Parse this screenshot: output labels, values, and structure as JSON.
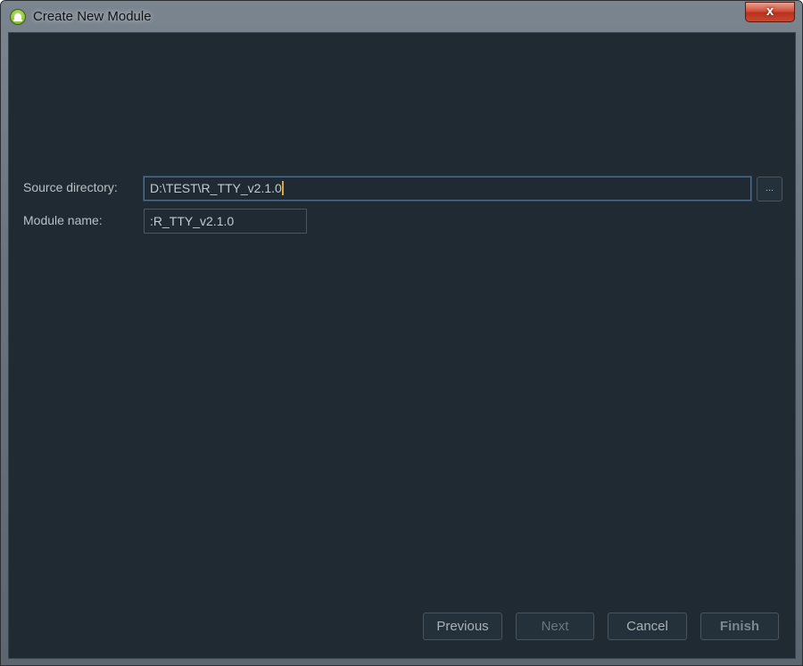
{
  "window": {
    "title": "Create New Module",
    "close_label": "x"
  },
  "form": {
    "source_directory": {
      "label": "Source directory:",
      "value": "D:\\TEST\\R_TTY_v2.1.0",
      "browse_label": "..."
    },
    "module_name": {
      "label": "Module name:",
      "value": ":R_TTY_v2.1.0"
    }
  },
  "buttons": {
    "previous": "Previous",
    "next": "Next",
    "cancel": "Cancel",
    "finish": "Finish"
  },
  "colors": {
    "background": "#1f2a32",
    "text": "#b9c0c6",
    "focus_border": "#4f6e8c",
    "caret": "#e0a23c",
    "close_button": "#c9482f"
  },
  "icons": {
    "app": "android-studio-icon"
  }
}
